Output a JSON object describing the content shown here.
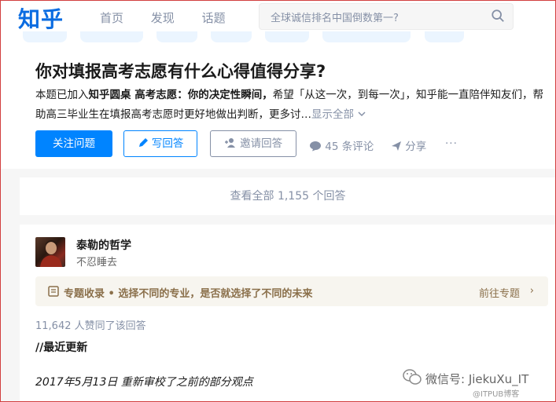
{
  "header": {
    "logo": "知乎",
    "nav": [
      "首页",
      "发现",
      "话题"
    ],
    "search_placeholder": "全球诚信排名中国倒数第一?"
  },
  "question": {
    "title": "你对填报高考志愿有什么心得值得分享?",
    "desc_prefix": "本题已加入",
    "desc_bold": "知乎圆桌 高考志愿：你的决定性瞬间，",
    "desc_rest": "希望「从这一次，到每一次」，知乎能一直陪伴知友们，帮助高三毕业生在填报高考志愿时更好地做出判断，更多讨…",
    "show_all": "显示全部",
    "follow_button": "关注问题",
    "write_button": "写回答",
    "invite_button": "邀请回答",
    "comments": "45 条评论",
    "share": "分享",
    "more": "···"
  },
  "view_all": "查看全部 1,155 个回答",
  "answer": {
    "author_name": "泰勒的哲学",
    "author_bio": "不忍睡去",
    "topic_text": "专题收录 • 选择不同的专业，是否就选择了不同的未来",
    "topic_link": "前往专题",
    "votes": "11,642 人赞同了该回答",
    "latest": "//最近更新",
    "revised": "2017年5月13日 重新审校了之前的部分观点"
  },
  "watermark": {
    "main": "微信号: JiekuXu_IT",
    "sub": "@ITPUB博客"
  },
  "colors": {
    "brand": "#0a6ce1",
    "primary": "#0084ff",
    "muted": "#8590a6",
    "topic": "#8a6f4a"
  }
}
